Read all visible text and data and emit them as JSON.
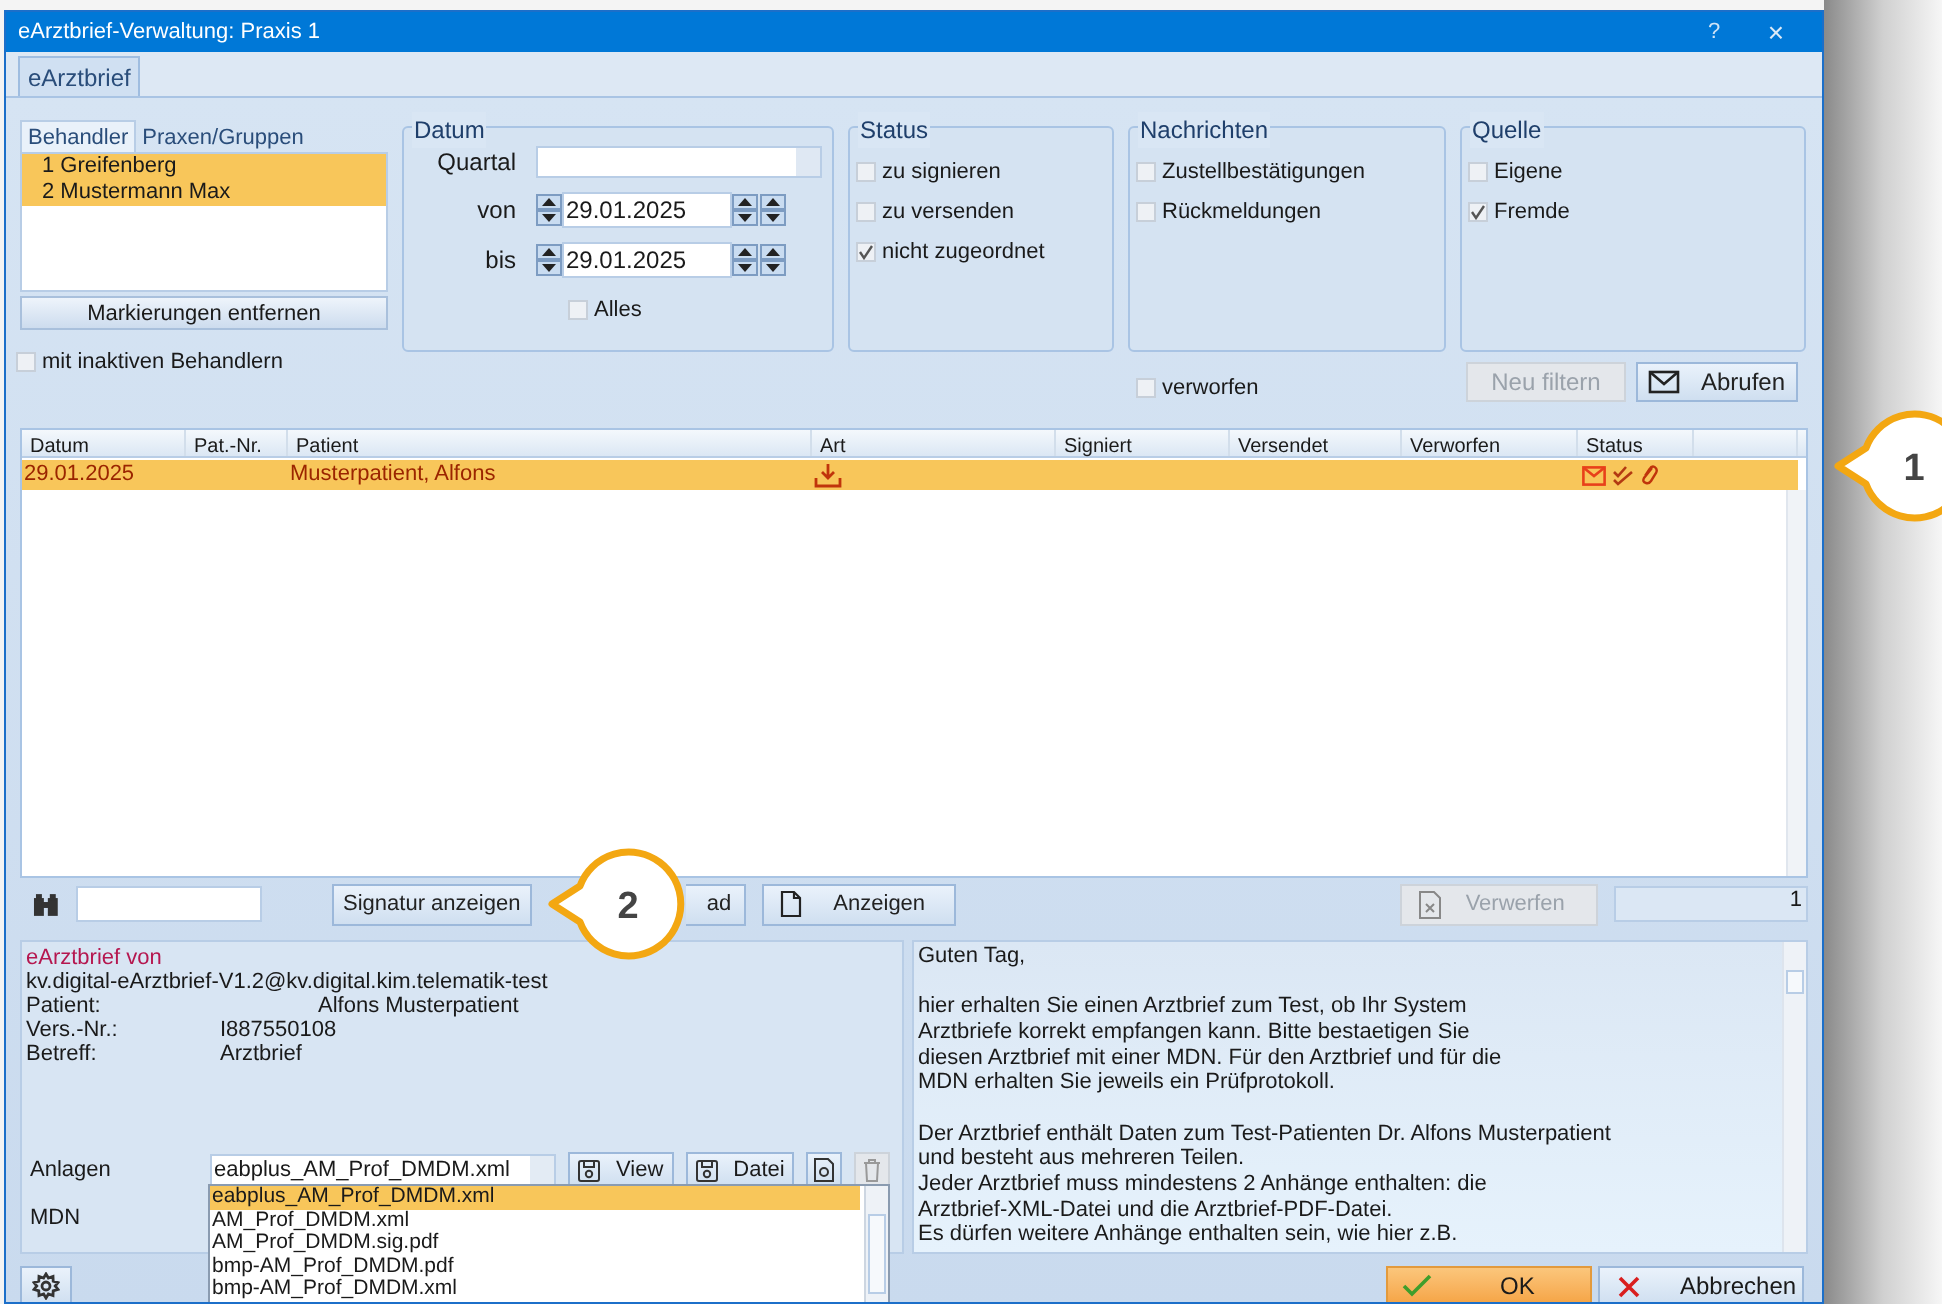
{
  "window": {
    "title": "eArztbrief-Verwaltung: Praxis 1",
    "help": "?",
    "close": "×"
  },
  "tabs": [
    {
      "label": "eArztbrief",
      "selected": true
    }
  ],
  "behandler": {
    "tabs": [
      {
        "label": "Behandler",
        "selected": true
      },
      {
        "label": "Praxen/Gruppen",
        "selected": false
      }
    ],
    "items": [
      {
        "label": "1 Greifenberg",
        "selected": true
      },
      {
        "label": "2 Mustermann Max",
        "selected": true
      }
    ],
    "clear_button": "Markierungen entfernen",
    "inactive": {
      "label": "mit inaktiven Behandlern",
      "checked": false
    }
  },
  "datum": {
    "title": "Datum",
    "quartal_label": "Quartal",
    "von_label": "von",
    "von": "29.01.2025",
    "bis_label": "bis",
    "bis": "29.01.2025",
    "alles": {
      "label": "Alles",
      "checked": false
    }
  },
  "status": {
    "title": "Status",
    "options": [
      {
        "label": "zu signieren",
        "checked": false
      },
      {
        "label": "zu versenden",
        "checked": false
      },
      {
        "label": "nicht zugeordnet",
        "checked": true
      }
    ]
  },
  "nachrichten": {
    "title": "Nachrichten",
    "options": [
      {
        "label": "Zustellbestätigungen",
        "checked": false
      },
      {
        "label": "Rückmeldungen",
        "checked": false
      }
    ]
  },
  "quelle": {
    "title": "Quelle",
    "options": [
      {
        "label": "Eigene",
        "checked": false
      },
      {
        "label": "Fremde",
        "checked": true
      }
    ]
  },
  "verworfen": {
    "label": "verworfen",
    "checked": false
  },
  "filter_buttons": [
    {
      "label": "Neu filtern",
      "disabled": true,
      "kind": "plain"
    },
    {
      "label": "Abrufen",
      "disabled": false,
      "kind": "mail"
    }
  ],
  "table": {
    "columns": [
      "Datum",
      "Pat.-Nr.",
      "Patient",
      "Art",
      "Signiert",
      "Versendet",
      "Verworfen",
      "Status"
    ],
    "rows": [
      {
        "datum": "29.01.2025",
        "patient": "Musterpatient, Alfons",
        "selected": true
      }
    ]
  },
  "toolbar": {
    "buttons": [
      {
        "label": "Signatur anzeigen",
        "kind": "plain",
        "disabled": false
      },
      {
        "label": "ad",
        "kind": "plain",
        "disabled": false
      },
      {
        "label": "Anzeigen",
        "kind": "doc",
        "disabled": false
      },
      {
        "label": "Verwerfen",
        "kind": "discard",
        "disabled": true
      }
    ],
    "count": "1"
  },
  "details": {
    "from_label": "eArztbrief von",
    "from": "kv.digital-eArztbrief-V1.2@kv.digital.kim.telematik-test",
    "fields": [
      {
        "label": "Patient:",
        "value": "Alfons Musterpatient"
      },
      {
        "label": "Vers.-Nr.:",
        "value": "I887550108"
      },
      {
        "label": "Betreff:",
        "value": "Arztbrief"
      }
    ],
    "anlagen_label": "Anlagen",
    "anlagen_value": "eabplus_AM_Prof_DMDM.xml",
    "view_button": "View",
    "datei_button": "Datei",
    "mdn_label": "MDN",
    "options": [
      {
        "label": "eabplus_AM_Prof_DMDM.xml",
        "selected": true
      },
      {
        "label": "AM_Prof_DMDM.xml",
        "selected": false
      },
      {
        "label": "AM_Prof_DMDM.sig.pdf",
        "selected": false
      },
      {
        "label": "bmp-AM_Prof_DMDM.pdf",
        "selected": false
      },
      {
        "label": "bmp-AM_Prof_DMDM.xml",
        "selected": false
      }
    ]
  },
  "message": [
    [
      "Guten Tag,"
    ],
    [
      "hier erhalten Sie einen Arztbrief zum Test, ob Ihr System",
      "Arztbriefe korrekt empfangen kann. Bitte bestaetigen Sie",
      "diesen Arztbrief mit einer MDN. Für den Arztbrief und für die",
      "MDN erhalten Sie jeweils ein Prüfprotokoll."
    ],
    [
      "Der Arztbrief enthält Daten zum Test-Patienten Dr. Alfons Musterpatient",
      "und besteht aus mehreren Teilen.",
      "Jeder Arztbrief muss mindestens 2 Anhänge enthalten: die",
      "Arztbrief-XML-Datei und die Arztbrief-PDF-Datei.",
      "Es dürfen weitere Anhänge enthalten sein, wie hier z.B."
    ]
  ],
  "footer_buttons": [
    {
      "label": "OK",
      "kind": "ok"
    },
    {
      "label": "Abbrechen",
      "kind": "cancel"
    }
  ],
  "callouts": [
    "1",
    "2"
  ]
}
